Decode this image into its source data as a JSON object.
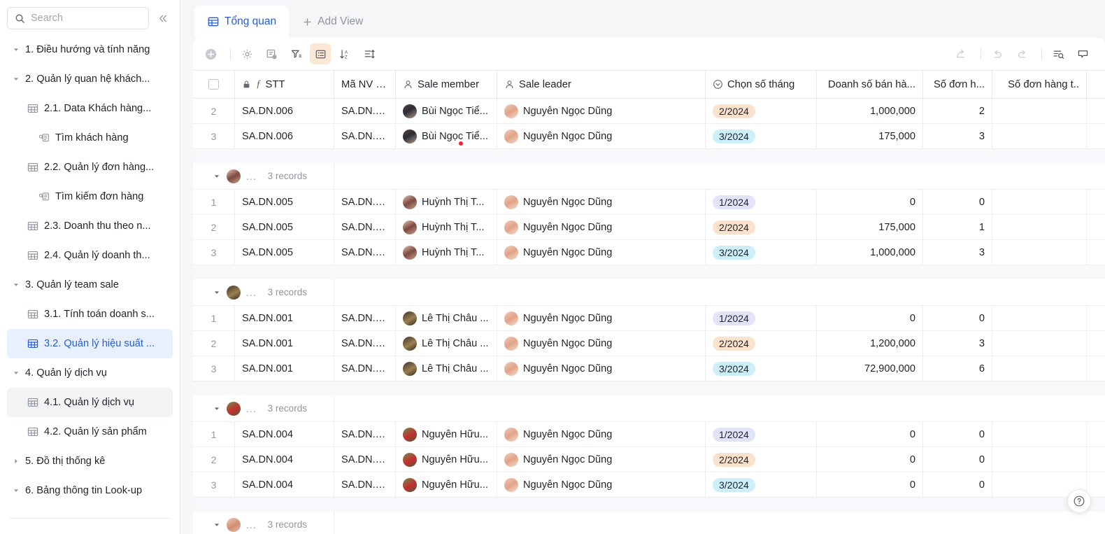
{
  "sidebar": {
    "search": {
      "placeholder": "Search",
      "icon": "search-icon"
    },
    "collapse_icon": "chevron-double-left-icon",
    "items": [
      {
        "label": "1. Điều hướng và tính năng",
        "level": 1,
        "caret": "down",
        "icon": null,
        "state": "none"
      },
      {
        "label": "2. Quản lý quan hệ khách...",
        "level": 1,
        "caret": "down",
        "icon": null,
        "state": "none"
      },
      {
        "label": "2.1. Data Khách hàng...",
        "level": 2,
        "caret": null,
        "icon": "table-icon",
        "state": "none"
      },
      {
        "label": "Tìm khách hàng",
        "level": 3,
        "caret": null,
        "icon": "form-search-icon",
        "state": "none"
      },
      {
        "label": "2.2. Quản lý đơn hàng...",
        "level": 2,
        "caret": null,
        "icon": "table-icon",
        "state": "none"
      },
      {
        "label": "Tìm kiếm đơn hàng",
        "level": 3,
        "caret": null,
        "icon": "form-search-icon",
        "state": "none"
      },
      {
        "label": "2.3. Doanh thu theo n...",
        "level": 2,
        "caret": null,
        "icon": "table-icon",
        "state": "none"
      },
      {
        "label": "2.4. Quản lý doanh th...",
        "level": 2,
        "caret": null,
        "icon": "table-icon",
        "state": "none"
      },
      {
        "label": "3. Quản lý team sale",
        "level": 1,
        "caret": "down",
        "icon": null,
        "state": "none"
      },
      {
        "label": "3.1. Tính toán doanh s...",
        "level": 2,
        "caret": null,
        "icon": "table-icon",
        "state": "none"
      },
      {
        "label": "3.2. Quản lý hiệu suất ...",
        "level": 2,
        "caret": null,
        "icon": "table-icon",
        "state": "selected"
      },
      {
        "label": "4. Quản lý dịch vụ",
        "level": 1,
        "caret": "down",
        "icon": null,
        "state": "none"
      },
      {
        "label": "4.1. Quản lý dịch vụ",
        "level": 2,
        "caret": null,
        "icon": "table-icon",
        "state": "hover"
      },
      {
        "label": "4.2. Quản lý sản phẩm",
        "level": 2,
        "caret": null,
        "icon": "table-icon",
        "state": "none"
      },
      {
        "label": "5. Đồ thị thống kê",
        "level": 1,
        "caret": "right",
        "icon": null,
        "state": "none"
      },
      {
        "label": "6. Bảng thông tin Look-up",
        "level": 1,
        "caret": "down",
        "icon": null,
        "state": "none"
      }
    ]
  },
  "tabs": [
    {
      "label": "Tổng quan",
      "icon": "grid-view-icon",
      "active": true
    },
    {
      "label": "Add View",
      "icon": "plus-icon",
      "active": false
    }
  ],
  "toolbar": {
    "left": [
      {
        "name": "add-record-button",
        "icon": "plus-circle-icon",
        "active": false
      },
      {
        "name": "field-settings-button",
        "icon": "gear-icon",
        "active": false
      },
      {
        "name": "field-config-button",
        "icon": "field-config-icon",
        "active": false
      },
      {
        "name": "filter-button",
        "icon": "filter-icon",
        "active": false
      },
      {
        "name": "group-button",
        "icon": "group-icon",
        "active": true
      },
      {
        "name": "sort-button",
        "icon": "sort-az-icon",
        "active": false
      },
      {
        "name": "row-height-button",
        "icon": "row-height-icon",
        "active": false
      }
    ],
    "right": [
      {
        "name": "share-button",
        "icon": "share-icon",
        "disabled": true
      },
      {
        "name": "undo-button",
        "icon": "undo-icon",
        "disabled": true
      },
      {
        "name": "redo-button",
        "icon": "redo-icon",
        "disabled": true
      },
      {
        "name": "search-records-button",
        "icon": "search-rows-icon",
        "disabled": false
      },
      {
        "name": "comment-button",
        "icon": "comment-icon",
        "disabled": false
      }
    ]
  },
  "table": {
    "columns": [
      {
        "key": "check",
        "label": "",
        "icon": "checkbox-icon"
      },
      {
        "key": "stt",
        "label": "STT",
        "icon": "lock-and-formula-icon"
      },
      {
        "key": "ma_nv",
        "label": "Mã NV S...",
        "icon": null
      },
      {
        "key": "member",
        "label": "Sale member",
        "icon": "person-icon"
      },
      {
        "key": "leader",
        "label": "Sale leader",
        "icon": "person-icon"
      },
      {
        "key": "month",
        "label": "Chọn số tháng",
        "icon": "single-select-icon"
      },
      {
        "key": "revenue",
        "label": "Doanh số bán hà...",
        "icon": null
      },
      {
        "key": "orders",
        "label": "Số đơn h...",
        "icon": null
      },
      {
        "key": "orders2",
        "label": "Số đơn hàng t..",
        "icon": null
      }
    ],
    "record_count_label": "3 records",
    "groups": [
      {
        "group_id": "group-bui-ngoc-tien",
        "partial_top": true,
        "rows": [
          {
            "stt": "2",
            "code": "SA.DN.006",
            "ma_nv": "SA.DN.0...",
            "member": "Bùi Ngọc Tiể...",
            "leader": "Nguyễn Ngọc Dũng",
            "month": "2/2024",
            "month_style": "p2",
            "revenue": "1,000,000",
            "orders": "2",
            "orders2": "",
            "marker": false
          },
          {
            "stt": "3",
            "code": "SA.DN.006",
            "ma_nv": "SA.DN.0...",
            "member": "Bùi Ngọc Tiể...",
            "leader": "Nguyễn Ngọc Dũng",
            "month": "3/2024",
            "month_style": "p3",
            "revenue": "175,000",
            "orders": "3",
            "orders2": "",
            "marker": true
          }
        ]
      },
      {
        "group_id": "group-huynh-thi-t",
        "partial_top": false,
        "rows": [
          {
            "stt": "1",
            "code": "SA.DN.005",
            "ma_nv": "SA.DN.0...",
            "member": "Huỳnh Thị T...",
            "leader": "Nguyễn Ngọc Dũng",
            "month": "1/2024",
            "month_style": "p1",
            "revenue": "0",
            "orders": "0",
            "orders2": "",
            "marker": false
          },
          {
            "stt": "2",
            "code": "SA.DN.005",
            "ma_nv": "SA.DN.0...",
            "member": "Huỳnh Thị T...",
            "leader": "Nguyễn Ngọc Dũng",
            "month": "2/2024",
            "month_style": "p2",
            "revenue": "175,000",
            "orders": "1",
            "orders2": "",
            "marker": false
          },
          {
            "stt": "3",
            "code": "SA.DN.005",
            "ma_nv": "SA.DN.0...",
            "member": "Huỳnh Thị T...",
            "leader": "Nguyễn Ngọc Dũng",
            "month": "3/2024",
            "month_style": "p3",
            "revenue": "1,000,000",
            "orders": "3",
            "orders2": "",
            "marker": false
          }
        ]
      },
      {
        "group_id": "group-le-thi-chau",
        "partial_top": false,
        "rows": [
          {
            "stt": "1",
            "code": "SA.DN.001",
            "ma_nv": "SA.DN.0...",
            "member": "Lê Thị Châu ...",
            "leader": "Nguyễn Ngọc Dũng",
            "month": "1/2024",
            "month_style": "p1",
            "revenue": "0",
            "orders": "0",
            "orders2": "",
            "marker": false
          },
          {
            "stt": "2",
            "code": "SA.DN.001",
            "ma_nv": "SA.DN.0...",
            "member": "Lê Thị Châu ...",
            "leader": "Nguyễn Ngọc Dũng",
            "month": "2/2024",
            "month_style": "p2",
            "revenue": "1,200,000",
            "orders": "3",
            "orders2": "",
            "marker": false
          },
          {
            "stt": "3",
            "code": "SA.DN.001",
            "ma_nv": "SA.DN.0...",
            "member": "Lê Thị Châu ...",
            "leader": "Nguyễn Ngọc Dũng",
            "month": "3/2024",
            "month_style": "p3",
            "revenue": "72,900,000",
            "orders": "6",
            "orders2": "",
            "marker": false
          }
        ]
      },
      {
        "group_id": "group-nguyen-huu",
        "partial_top": false,
        "rows": [
          {
            "stt": "1",
            "code": "SA.DN.004",
            "ma_nv": "SA.DN.0...",
            "member": "Nguyễn Hữu...",
            "leader": "Nguyễn Ngọc Dũng",
            "month": "1/2024",
            "month_style": "p1",
            "revenue": "0",
            "orders": "0",
            "orders2": "",
            "marker": false
          },
          {
            "stt": "2",
            "code": "SA.DN.004",
            "ma_nv": "SA.DN.0...",
            "member": "Nguyễn Hữu...",
            "leader": "Nguyễn Ngọc Dũng",
            "month": "2/2024",
            "month_style": "p2",
            "revenue": "0",
            "orders": "0",
            "orders2": "",
            "marker": false
          },
          {
            "stt": "3",
            "code": "SA.DN.004",
            "ma_nv": "SA.DN.0...",
            "member": "Nguyễn Hữu...",
            "leader": "Nguyễn Ngọc Dũng",
            "month": "3/2024",
            "month_style": "p3",
            "revenue": "0",
            "orders": "0",
            "orders2": "",
            "marker": false
          }
        ]
      },
      {
        "group_id": "group-last-partial",
        "partial_top": false,
        "rows": []
      }
    ]
  },
  "help": {
    "icon": "question-circle-icon",
    "label": "?"
  },
  "colors": {
    "accent": "#245bdb",
    "selected_nav_bg": "#e8f0fe",
    "active_tool_bg": "#fde8d4",
    "pill_jan": "#e1e4fb",
    "pill_feb": "#fbe2cd",
    "pill_mar": "#cdeefb",
    "marker_red": "#f5222d"
  }
}
